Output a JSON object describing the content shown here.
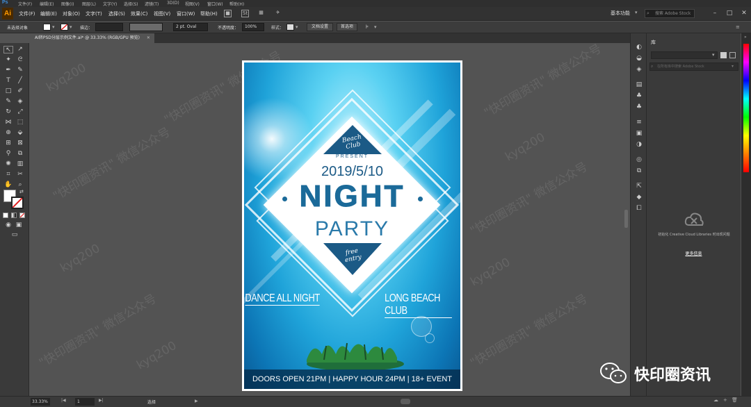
{
  "ps_strip": {
    "logo": "Ps",
    "menus": [
      "文件(F)",
      "编辑(E)",
      "图像(I)",
      "图层(L)",
      "文字(Y)",
      "选择(S)",
      "滤镜(T)",
      "3D(D)",
      "视图(V)",
      "窗口(W)",
      "帮助(H)"
    ]
  },
  "app": {
    "logo": "Ai"
  },
  "menubar": {
    "items": [
      "文件(F)",
      "编辑(E)",
      "对象(O)",
      "文字(T)",
      "选择(S)",
      "效果(C)",
      "视图(V)",
      "窗口(W)",
      "帮助(H)"
    ],
    "workspace": "基本功能",
    "stock_search_placeholder": "搜索 Adobe Stock"
  },
  "controlbar": {
    "selection_label": "未选择对象",
    "stroke_label": "描边：",
    "stroke_value": "2 pt. Oval",
    "opacity_label": "不透明度：",
    "opacity_value": "100%",
    "style_label": "样式：",
    "doc_setup": "文档设置",
    "preferences": "首选项",
    "colors": {
      "fill": "#ffffff",
      "stroke": "#ffffff"
    }
  },
  "tab": {
    "title": "AI转PSD分层示例文件.ai* @ 33.33% (RGB/GPU 预览)",
    "close": "✕"
  },
  "poster": {
    "beach_club": "Beach Club",
    "present": "PRESENT",
    "date": "2019/5/10",
    "night": "NIGHT",
    "party": "PARTY",
    "free_entry": "free entry",
    "left_tagline": "DANCE ALL NIGHT",
    "right_tagline": "LONG BEACH CLUB",
    "bottom_bar": "DOORS OPEN 21PM | HAPPY HOUR 24PM | 18+ EVENT",
    "colors": {
      "sky_top": "#c7f4ff",
      "sky_mid": "#1fa3d9",
      "sky_bottom": "#0a5a94",
      "text_dark": "#1b6a99"
    }
  },
  "watermarks": [
    "kyq200",
    "\"快印圈资讯\" 微信公众号"
  ],
  "status": {
    "zoom": "33.33%",
    "page": "1",
    "tool": "选择"
  },
  "libraries": {
    "tab": "库",
    "search_placeholder": "在所有库中搜索 Adobe Stock",
    "message": "初始化 Creative Cloud Libraries 时出现问题",
    "link": "更多信息"
  },
  "brand": {
    "name": "快印圈资讯"
  }
}
